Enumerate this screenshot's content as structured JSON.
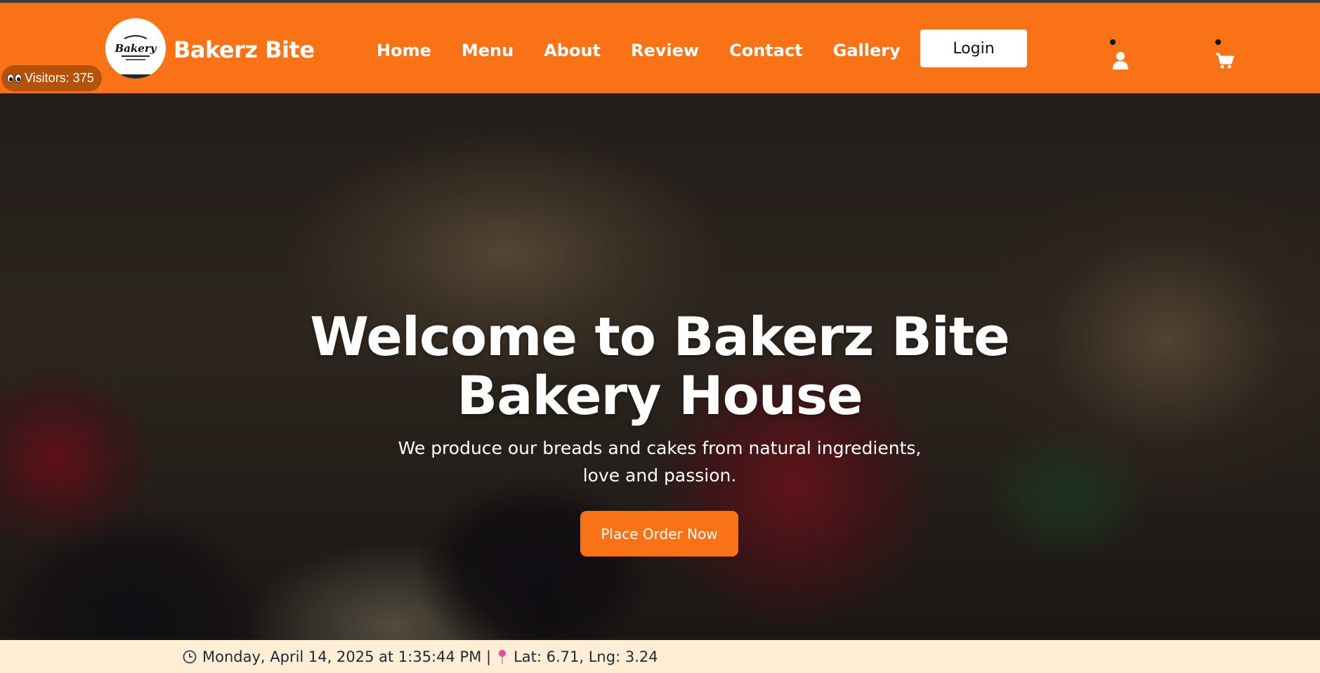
{
  "brand": {
    "name": "Bakerz Bite",
    "logo_text": "Bakery"
  },
  "visitors": {
    "label": "Visitors: 375"
  },
  "nav": {
    "links": [
      "Home",
      "Menu",
      "About",
      "Review",
      "Contact",
      "Gallery"
    ],
    "login_label": "Login",
    "icons": [
      "user-icon",
      "cart-icon"
    ]
  },
  "hero": {
    "title_line1": "Welcome to Bakerz Bite",
    "title_line2": "Bakery House",
    "subtitle": "We produce our breads and cakes from natural ingredients, love and passion.",
    "cta_label": "Place Order Now"
  },
  "footer": {
    "datetime": "Monday, April 14, 2025 at 1:35:44 PM |",
    "location": "Lat: 6.71, Lng: 3.24"
  },
  "colors": {
    "accent": "#f97316",
    "visitor_badge": "#b45309",
    "footer_bg": "#ffedd5"
  }
}
